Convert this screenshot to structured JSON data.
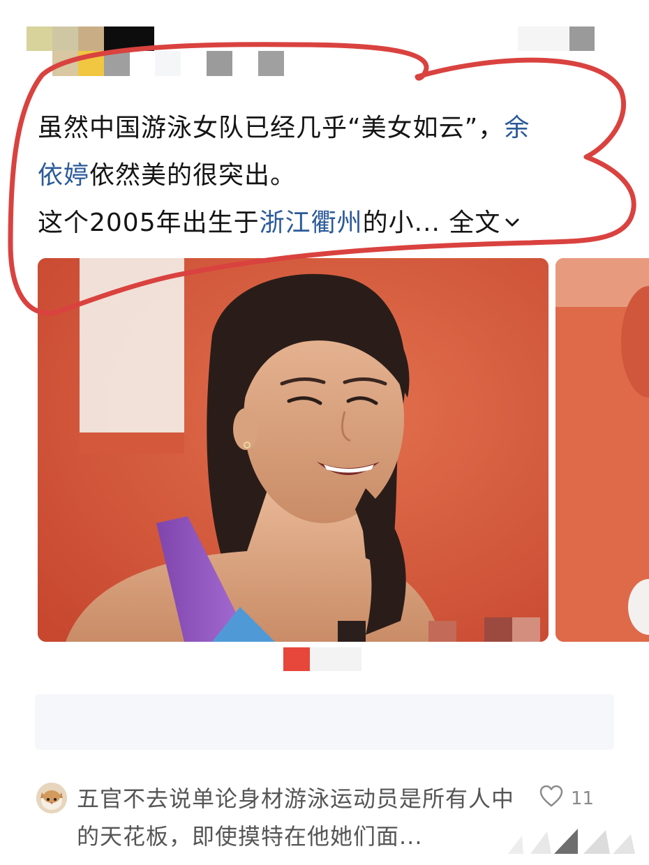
{
  "post": {
    "line1_before": "虽然中国游泳女队已经几乎“美女如云”，",
    "line1_link": "余",
    "line2_link": "依婷",
    "line2_after": "依然美的很突出。",
    "line3_before": "这个2005年出生于",
    "line3_link": "浙江衢州",
    "line3_after": "的小... ",
    "expand_label": "全文"
  },
  "comment": {
    "text": "五官不去说单论身材游泳运动员是所有人中的天花板，即使摸特在他她们面...",
    "like_count": "11"
  },
  "colors": {
    "annotation": "#d9423f",
    "link": "#2b5a99",
    "photo_background": "#d95a3e",
    "swimsuit_purple": "#8a4fb5",
    "swimsuit_blue": "#4f9ad6"
  },
  "icons": {
    "expand": "chevron-down-icon",
    "like": "heart-icon"
  }
}
